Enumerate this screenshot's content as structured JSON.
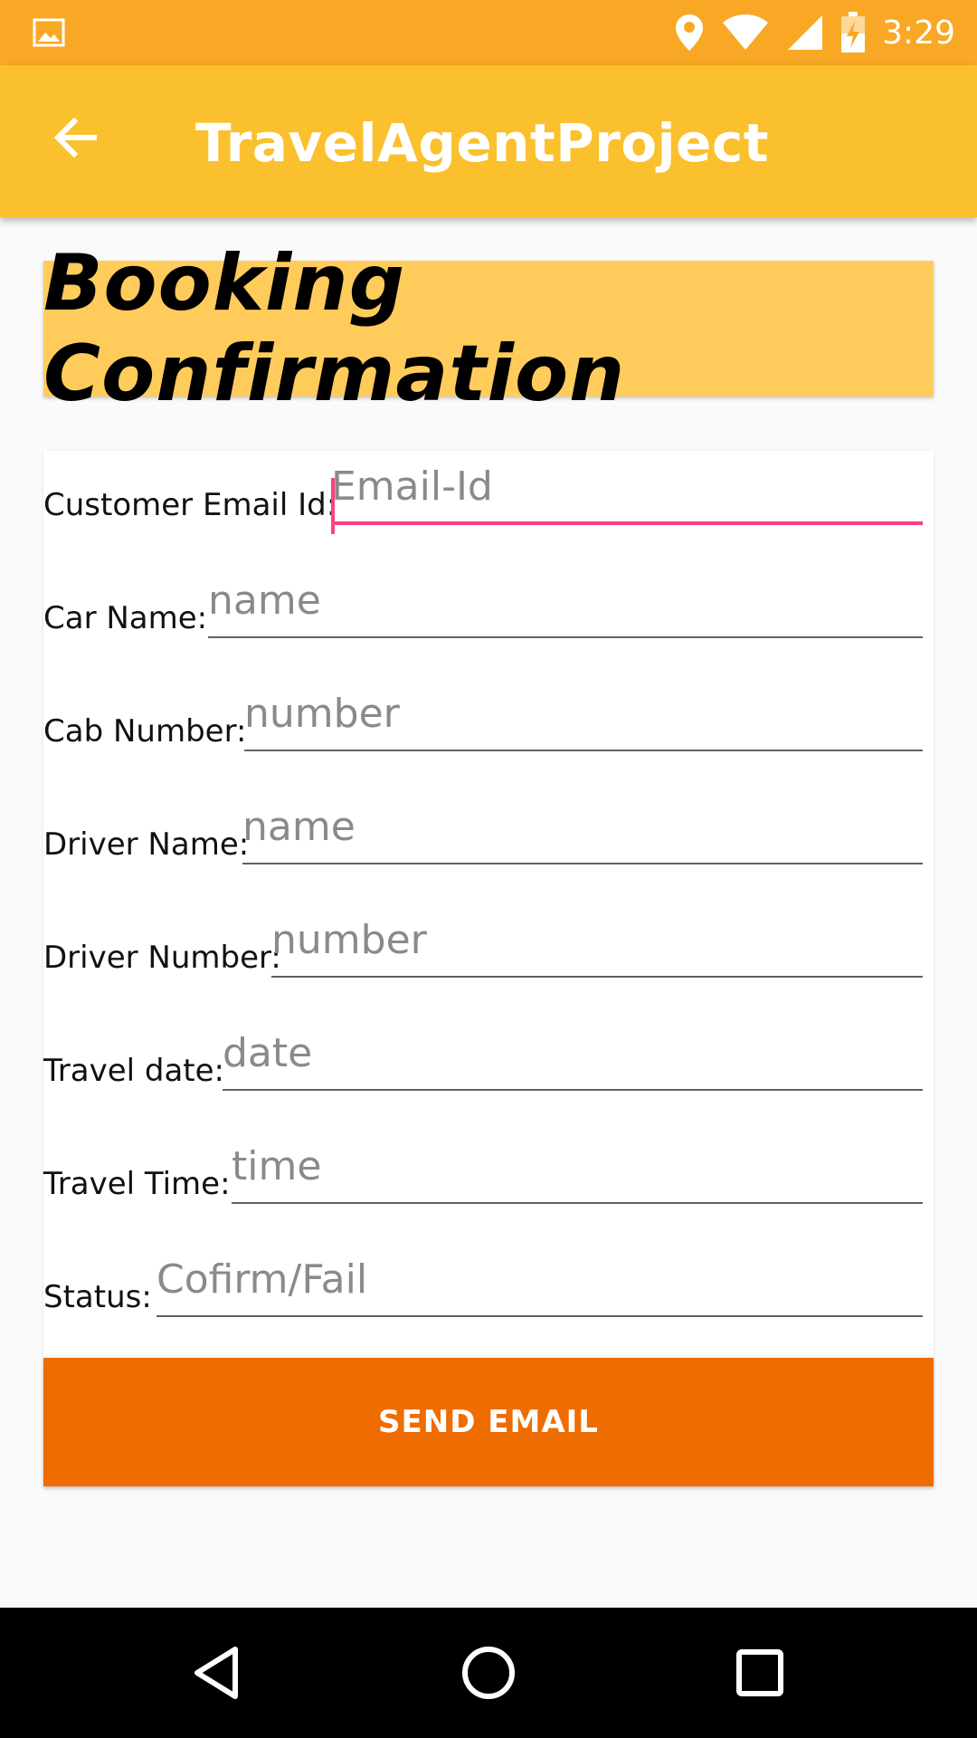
{
  "status_bar": {
    "time": "3:29",
    "icons": [
      "image-icon",
      "location-icon",
      "wifi-icon",
      "signal-icon",
      "battery-charging-icon"
    ]
  },
  "app_bar": {
    "title": "TravelAgentProject",
    "back_icon": "arrow-back-icon"
  },
  "heading": "Booking Confirmation",
  "form": {
    "fields": [
      {
        "label": "Customer Email Id:",
        "placeholder": "Email-Id",
        "value": ""
      },
      {
        "label": "Car Name:",
        "placeholder": "name",
        "value": ""
      },
      {
        "label": "Cab Number:",
        "placeholder": "number",
        "value": ""
      },
      {
        "label": "Driver Name:",
        "placeholder": "name",
        "value": ""
      },
      {
        "label": "Driver Number:",
        "placeholder": "number",
        "value": ""
      },
      {
        "label": "Travel date:",
        "placeholder": "date",
        "value": ""
      },
      {
        "label": "Travel Time:",
        "placeholder": "time",
        "value": ""
      },
      {
        "label": "Status:",
        "placeholder": "Cofirm/Fail",
        "value": ""
      }
    ]
  },
  "send_button": "SEND EMAIL",
  "nav_bar": {
    "icons": [
      "back-triangle-icon",
      "home-circle-icon",
      "recents-square-icon"
    ]
  },
  "colors": {
    "status_bar": "#f9a825",
    "app_bar": "#fbc02d",
    "banner": "#ffcc5c",
    "button": "#ef6c00",
    "focus_accent": "#ff4081"
  }
}
